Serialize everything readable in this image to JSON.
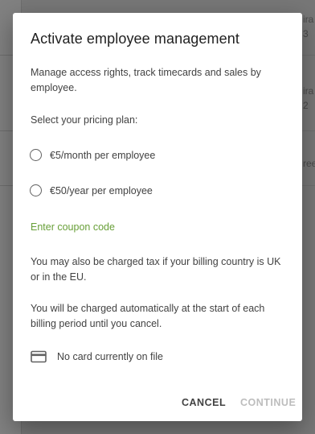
{
  "background": {
    "fragments": [
      "ira",
      "3",
      "ira",
      "2",
      "ree"
    ]
  },
  "dialog": {
    "title": "Activate employee management",
    "description": "Manage access rights, track timecards and sales by employee.",
    "plan_prompt": "Select your pricing plan:",
    "plans": [
      {
        "label": "€5/month per employee",
        "selected": false
      },
      {
        "label": "€50/year per employee",
        "selected": false
      }
    ],
    "coupon_link": "Enter coupon code",
    "tax_note": "You may also be charged tax if your billing country is UK or in the EU.",
    "billing_note": "You will be charged automatically at the start of each billing period until you cancel.",
    "card_status": "No card currently on file",
    "cancel_label": "CANCEL",
    "continue_label": "CONTINUE"
  },
  "colors": {
    "link": "#689f38",
    "disabled": "#bdbdbd"
  },
  "icons": {
    "card": "credit-card-icon"
  }
}
